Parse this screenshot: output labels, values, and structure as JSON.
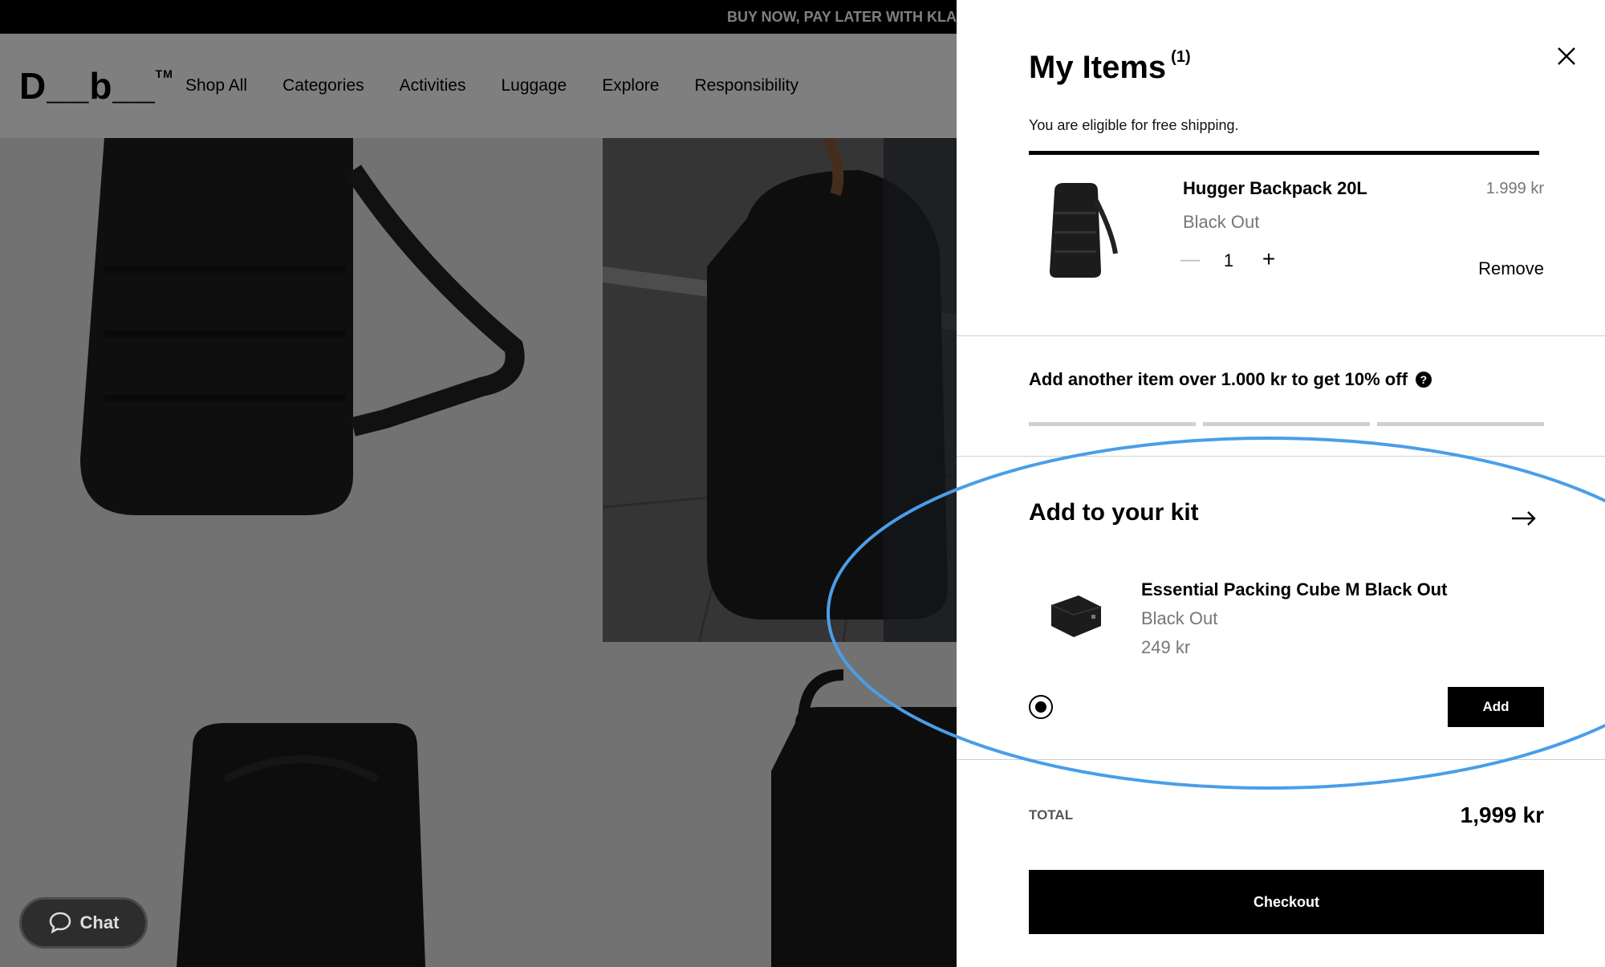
{
  "promo": {
    "text": "BUY NOW, PAY LATER WITH KLAR"
  },
  "brand": {
    "logo": "D__b__",
    "trademark": "TM"
  },
  "nav": {
    "items": [
      {
        "label": "Shop All"
      },
      {
        "label": "Categories"
      },
      {
        "label": "Activities"
      },
      {
        "label": "Luggage"
      },
      {
        "label": "Explore"
      },
      {
        "label": "Responsibility"
      }
    ]
  },
  "chat": {
    "label": "Chat",
    "icon": "chat-bubble-icon"
  },
  "cart": {
    "title": "My Items",
    "count": "(1)",
    "free_shipping": "You are eligible for free shipping.",
    "free_shipping_progress": 1.0,
    "item": {
      "name": "Hugger Backpack 20L",
      "variant": "Black Out",
      "price": "1.999 kr",
      "quantity": "1",
      "minus": "—",
      "plus": "+",
      "remove_label": "Remove",
      "image": "backpack-product-image"
    },
    "discount": {
      "text": "Add another item over 1.000 kr to get 10% off",
      "help": "?",
      "segments": 3,
      "filled_segments": 0
    },
    "kit": {
      "title": "Add to your kit",
      "item": {
        "name": "Essential Packing Cube M Black Out",
        "variant": "Black Out",
        "price": "249 kr",
        "image": "packing-cube-product-image"
      },
      "add_label": "Add"
    },
    "total": {
      "label": "TOTAL",
      "value": "1,999 kr"
    },
    "checkout_label": "Checkout"
  },
  "colors": {
    "accent": "#000000",
    "annotation": "#4a9ee8",
    "muted": "#777777"
  }
}
